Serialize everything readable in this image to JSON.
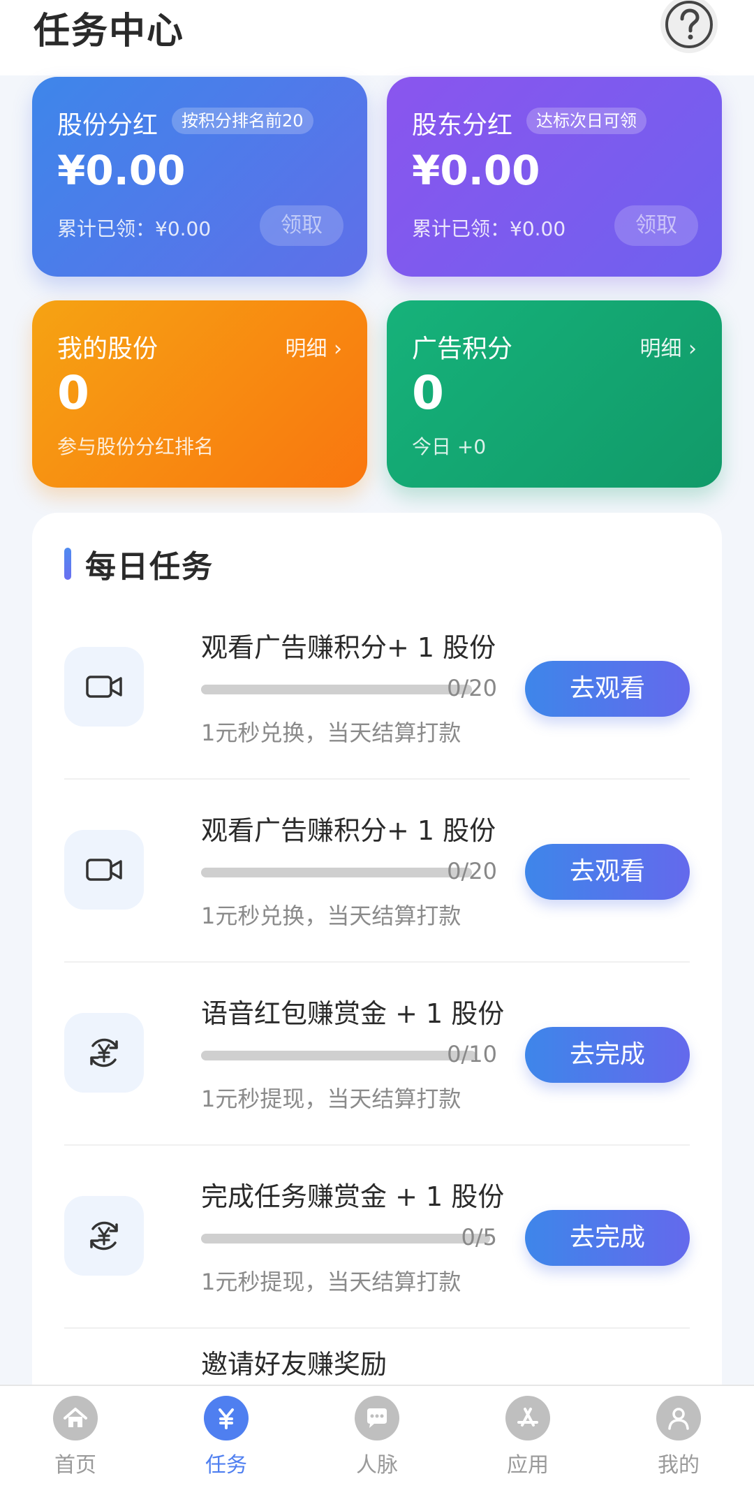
{
  "header": {
    "title": "任务中心"
  },
  "cards": {
    "dividend": {
      "title": "股份分红",
      "badge": "按积分排名前20",
      "amount": "¥0.00",
      "foot": "累计已领：¥0.00",
      "claim": "领取"
    },
    "shareholder": {
      "title": "股东分红",
      "badge": "达标次日可领",
      "amount": "¥0.00",
      "foot": "累计已领：¥0.00",
      "claim": "领取"
    },
    "shares": {
      "title": "我的股份",
      "detail": "明细 ›",
      "value": "0",
      "sub": "参与股份分红排名"
    },
    "points": {
      "title": "广告积分",
      "detail": "明细 ›",
      "value": "0",
      "sub": "今日 +0"
    }
  },
  "daily": {
    "title": "每日任务",
    "tasks": [
      {
        "name": "观看广告赚积分+ 1 股份",
        "count": "0/20",
        "progress": 0,
        "desc": "1元秒兑换，当天结算打款",
        "button": "去观看",
        "icon": "video-icon"
      },
      {
        "name": "观看广告赚积分+ 1 股份",
        "count": "0/20",
        "progress": 0,
        "desc": "1元秒兑换，当天结算打款",
        "button": "去观看",
        "icon": "video-icon"
      },
      {
        "name": "语音红包赚赏金 + 1 股份",
        "count": "0/10",
        "progress": 0,
        "desc": "1元秒提现，当天结算打款",
        "button": "去完成",
        "icon": "yuan-cycle-icon"
      },
      {
        "name": "完成任务赚赏金 + 1 股份",
        "count": "0/5",
        "progress": 0,
        "desc": "1元秒提现，当天结算打款",
        "button": "去完成",
        "icon": "yuan-cycle-icon"
      },
      {
        "name": "邀请好友赚奖励"
      }
    ]
  },
  "nav": {
    "items": [
      {
        "label": "首页",
        "icon": "home-icon"
      },
      {
        "label": "任务",
        "icon": "yuan-icon",
        "active": true
      },
      {
        "label": "人脉",
        "icon": "chat-icon"
      },
      {
        "label": "应用",
        "icon": "app-store-icon"
      },
      {
        "label": "我的",
        "icon": "user-icon"
      }
    ]
  },
  "colors": {
    "accent": "#4f7ff0",
    "blue_card": "#3e86ea",
    "purple_card": "#8a55ee",
    "orange_card": "#f9760f",
    "green_card": "#16b27a"
  }
}
